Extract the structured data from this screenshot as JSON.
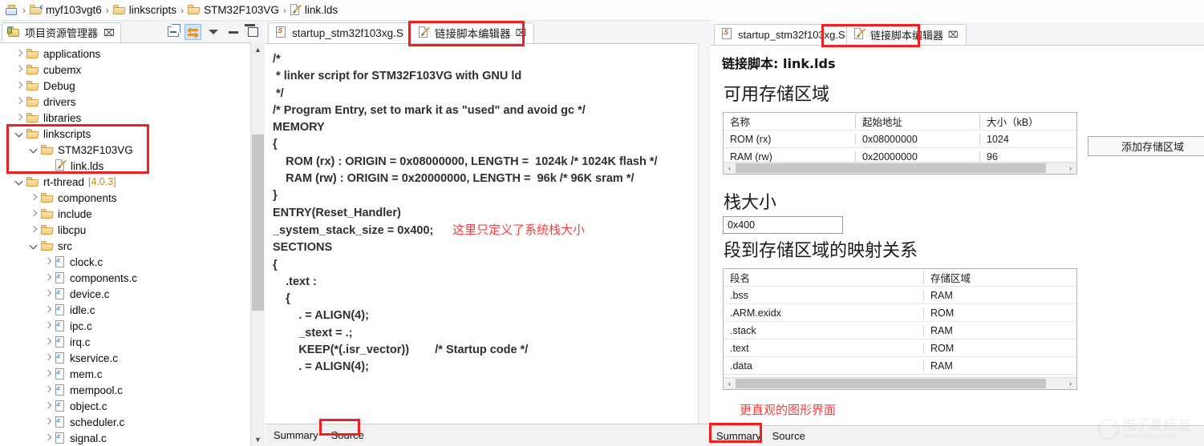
{
  "breadcrumb": {
    "items": [
      {
        "icon": "workspace-icon",
        "label": ""
      },
      {
        "icon": "project-folder-icon",
        "label": "myf103vgt6"
      },
      {
        "icon": "folder-icon",
        "label": "linkscripts"
      },
      {
        "icon": "folder-icon",
        "label": "STM32F103VG"
      },
      {
        "icon": "lds-file-icon",
        "label": "link.lds"
      }
    ],
    "separator": "›"
  },
  "explorer": {
    "tab_label": "项目资源管理器",
    "tab_close": "⌧",
    "toolbar": [
      {
        "name": "collapse-all-icon",
        "title": "collapse-all"
      },
      {
        "name": "link-with-editor-icon",
        "title": "link-with-editor"
      },
      {
        "name": "view-menu-icon",
        "title": "view-menu"
      },
      {
        "name": "minimize-icon",
        "title": "minimize"
      },
      {
        "name": "maximize-icon",
        "title": "maximize"
      }
    ],
    "tree": [
      {
        "label": "applications",
        "icon": "folder-icon",
        "depth": 1,
        "state": "collapsed"
      },
      {
        "label": "cubemx",
        "icon": "folder-icon",
        "depth": 1,
        "state": "collapsed"
      },
      {
        "label": "Debug",
        "icon": "folder-icon",
        "depth": 1,
        "state": "collapsed"
      },
      {
        "label": "drivers",
        "icon": "folder-icon",
        "depth": 1,
        "state": "collapsed"
      },
      {
        "label": "libraries",
        "icon": "folder-icon",
        "depth": 1,
        "state": "collapsed"
      },
      {
        "label": "linkscripts",
        "icon": "folder-icon",
        "depth": 1,
        "state": "expanded"
      },
      {
        "label": "STM32F103VG",
        "icon": "folder-icon",
        "depth": 2,
        "state": "expanded"
      },
      {
        "label": "link.lds",
        "icon": "lds-file-icon",
        "depth": 3,
        "state": "leaf"
      },
      {
        "label": "rt-thread",
        "icon": "folder-icon",
        "depth": 1,
        "state": "expanded",
        "version": "[4.0.3]"
      },
      {
        "label": "components",
        "icon": "folder-icon",
        "depth": 2,
        "state": "collapsed"
      },
      {
        "label": "include",
        "icon": "folder-icon",
        "depth": 2,
        "state": "collapsed"
      },
      {
        "label": "libcpu",
        "icon": "folder-icon",
        "depth": 2,
        "state": "collapsed"
      },
      {
        "label": "src",
        "icon": "folder-icon",
        "depth": 2,
        "state": "expanded"
      },
      {
        "label": "clock.c",
        "icon": "c-file-icon",
        "depth": 3,
        "state": "collapsed"
      },
      {
        "label": "components.c",
        "icon": "c-file-icon",
        "depth": 3,
        "state": "collapsed"
      },
      {
        "label": "device.c",
        "icon": "c-file-icon",
        "depth": 3,
        "state": "collapsed"
      },
      {
        "label": "idle.c",
        "icon": "c-file-icon",
        "depth": 3,
        "state": "collapsed"
      },
      {
        "label": "ipc.c",
        "icon": "c-file-icon",
        "depth": 3,
        "state": "collapsed"
      },
      {
        "label": "irq.c",
        "icon": "c-file-icon",
        "depth": 3,
        "state": "collapsed"
      },
      {
        "label": "kservice.c",
        "icon": "c-file-icon",
        "depth": 3,
        "state": "collapsed"
      },
      {
        "label": "mem.c",
        "icon": "c-file-icon",
        "depth": 3,
        "state": "collapsed"
      },
      {
        "label": "mempool.c",
        "icon": "c-file-icon",
        "depth": 3,
        "state": "collapsed"
      },
      {
        "label": "object.c",
        "icon": "c-file-icon",
        "depth": 3,
        "state": "collapsed"
      },
      {
        "label": "scheduler.c",
        "icon": "c-file-icon",
        "depth": 3,
        "state": "collapsed"
      },
      {
        "label": "signal.c",
        "icon": "c-file-icon",
        "depth": 3,
        "state": "collapsed"
      }
    ]
  },
  "editor": {
    "tabs": [
      {
        "label": "startup_stm32f103xg.S",
        "icon": "asm-file-icon",
        "active": false,
        "close": ""
      },
      {
        "label": "链接脚本编辑器",
        "icon": "lds-file-icon",
        "active": true,
        "close": "⌧"
      }
    ],
    "source": "/*\n * linker script for STM32F103VG with GNU ld\n */\n\n/* Program Entry, set to mark it as \"used\" and avoid gc */\nMEMORY\n{\n    ROM (rx) : ORIGIN = 0x08000000, LENGTH =  1024k /* 1024K flash */\n    RAM (rw) : ORIGIN = 0x20000000, LENGTH =  96k /* 96K sram */\n}\nENTRY(Reset_Handler)\n_system_stack_size = 0x400;\n\nSECTIONS\n{\n    .text :\n    {\n        . = ALIGN(4);\n        _stext = .;\n        KEEP(*(.isr_vector))        /* Startup code */\n\n        . = ALIGN(4);",
    "annotation": "这里只定义了系统栈大小",
    "bottom_tabs": [
      {
        "label": "Summary",
        "active": false
      },
      {
        "label": "Source",
        "active": true
      }
    ]
  },
  "linker_panel": {
    "tabs": [
      {
        "label": "startup_stm32f103xg.S",
        "icon": "asm-file-icon",
        "active": false,
        "close": ""
      },
      {
        "label": "链接脚本编辑器",
        "icon": "lds-file-icon",
        "active": true,
        "close": "⌧"
      }
    ],
    "title": "链接脚本: link.lds",
    "memory_section": {
      "heading": "可用存储区域",
      "columns": [
        "名称",
        "起始地址",
        "大小（kB）"
      ],
      "rows": [
        [
          "ROM (rx)",
          "0x08000000",
          "1024"
        ],
        [
          "RAM (rw)",
          "0x20000000",
          "96"
        ]
      ],
      "add_button": "添加存储区域"
    },
    "stack_section": {
      "heading": "栈大小",
      "value": "0x400"
    },
    "mapping_section": {
      "heading": "段到存储区域的映射关系",
      "columns": [
        "段名",
        "存储区域"
      ],
      "rows": [
        [
          ".bss",
          "RAM"
        ],
        [
          ".ARM.exidx",
          "ROM"
        ],
        [
          ".stack",
          "RAM"
        ],
        [
          ".text",
          "ROM"
        ],
        [
          ".data",
          "RAM"
        ]
      ]
    },
    "annotation": "更直观的图形界面",
    "bottom_tabs": [
      {
        "label": "Summary",
        "active": true
      },
      {
        "label": "Source",
        "active": false
      }
    ],
    "scroll_left": "‹",
    "scroll_right": "›"
  },
  "watermark": {
    "text": "电子发烧友",
    "url": "www.elecfans.com"
  },
  "colors": {
    "annotation_red": "#fa3c3c",
    "highlight_box": "#f02020",
    "folder": "#f6cb7a",
    "tab_active": "#ffffff"
  }
}
